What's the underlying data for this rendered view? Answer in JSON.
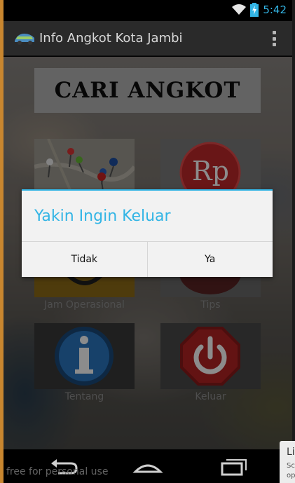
{
  "status_bar": {
    "time": "5:42",
    "icons": [
      "wifi-icon",
      "battery-charging-icon"
    ]
  },
  "action_bar": {
    "app_title": "Info Angkot Kota Jambi",
    "app_icon": "angkot-logo-icon",
    "menu_icon": "overflow-menu-icon"
  },
  "main": {
    "banner_title": "CARI ANGKOT",
    "tiles": [
      {
        "label": "",
        "icon": "map-pins-icon"
      },
      {
        "label": "",
        "icon": "rupiah-icon"
      },
      {
        "label": "Jam Operasional",
        "icon": "clock-icon"
      },
      {
        "label": "Tips",
        "icon": "tips-icon"
      },
      {
        "label": "Tentang",
        "icon": "info-icon"
      },
      {
        "label": "Keluar",
        "icon": "power-icon"
      }
    ],
    "rupiah_symbol": "Rp"
  },
  "dialog": {
    "title": "Yakin Ingin Keluar",
    "negative_label": "Tidak",
    "positive_label": "Ya",
    "accent_color": "#33b5e5"
  },
  "nav_bar": {
    "buttons": [
      "back-icon",
      "home-icon",
      "recent-apps-icon"
    ],
    "watermark": "free for personal use"
  },
  "side_popup": {
    "line1": "Li",
    "line2": "Sc",
    "line3": "op"
  }
}
